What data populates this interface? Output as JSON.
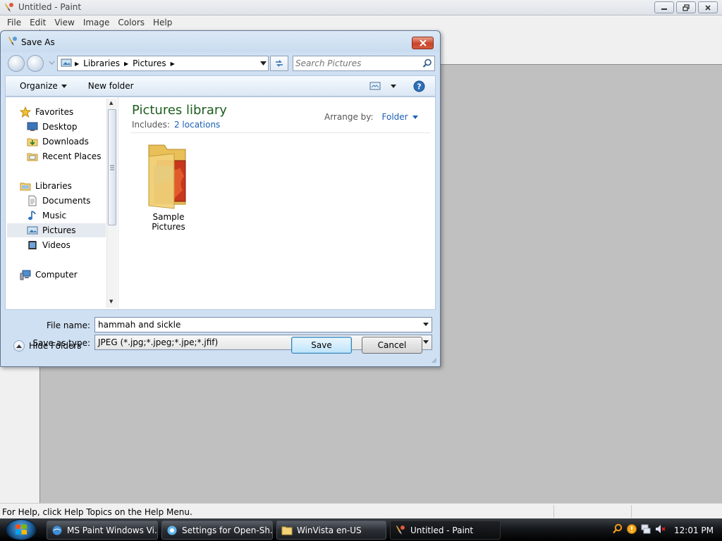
{
  "paint": {
    "title": "Untitled - Paint",
    "menu": [
      "File",
      "Edit",
      "View",
      "Image",
      "Colors",
      "Help"
    ],
    "status": "For Help, click Help Topics on the Help Menu."
  },
  "dialog": {
    "title": "Save As",
    "breadcrumb": [
      "Libraries",
      "Pictures"
    ],
    "search_placeholder": "Search Pictures",
    "toolbar": {
      "organize": "Organize",
      "new_folder": "New folder"
    },
    "nav": {
      "favorites": "Favorites",
      "desktop": "Desktop",
      "downloads": "Downloads",
      "recent_places": "Recent Places",
      "libraries": "Libraries",
      "documents": "Documents",
      "music": "Music",
      "pictures": "Pictures",
      "videos": "Videos",
      "computer": "Computer",
      "selected": "Pictures"
    },
    "library": {
      "title": "Pictures library",
      "includes_label": "Includes:",
      "includes_link": "2 locations",
      "arrange_label": "Arrange by:",
      "arrange_value": "Folder"
    },
    "items": [
      {
        "name": "Sample Pictures",
        "type": "folder"
      }
    ],
    "file_name_label": "File name:",
    "file_name_value": "hammah and sickle",
    "save_type_label": "Save as type:",
    "save_type_value": "JPEG (*.jpg;*.jpeg;*.jpe;*.jfif)",
    "hide_folders": "Hide Folders",
    "save_button": "Save",
    "cancel_button": "Cancel"
  },
  "taskbar": {
    "buttons": [
      {
        "label": "MS Paint Windows Vi...",
        "active": false
      },
      {
        "label": "Settings for Open-Sh...",
        "active": false
      },
      {
        "label": "WinVista en-US",
        "active": false
      },
      {
        "label": "Untitled - Paint",
        "active": true
      }
    ],
    "clock": "12:01 PM"
  },
  "colors": {
    "library_title": "#1e5f1e",
    "link": "#1a5fb4",
    "close_button": "#c9442a",
    "taskbar": "#15181c"
  }
}
